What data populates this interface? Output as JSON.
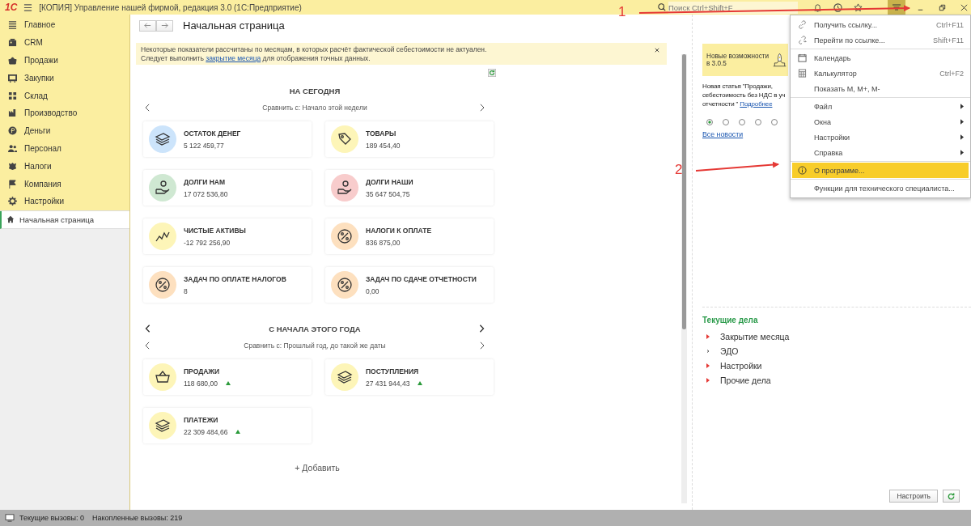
{
  "titlebar": {
    "logo": "1С",
    "title": "[КОПИЯ] Управление нашей фирмой, редакция 3.0  (1С:Предприятие)",
    "search": {
      "placeholder": "Поиск Ctrl+Shift+F"
    },
    "menu_open": true
  },
  "sidebar": {
    "items": [
      {
        "label": "Главное"
      },
      {
        "label": "CRM"
      },
      {
        "label": "Продажи"
      },
      {
        "label": "Закупки"
      },
      {
        "label": "Склад"
      },
      {
        "label": "Производство"
      },
      {
        "label": "Деньги"
      },
      {
        "label": "Персонал"
      },
      {
        "label": "Налоги"
      },
      {
        "label": "Компания"
      },
      {
        "label": "Настройки"
      }
    ],
    "open_windows": [
      {
        "label": "Начальная страница",
        "selected": true
      }
    ]
  },
  "page": {
    "title": "Начальная страница",
    "notice": {
      "line1": "Некоторые показатели рассчитаны по месяцам, в которых расчёт фактической себестоимости не актуален.",
      "line2_before": "Следует выполнить ",
      "link": "закрытие месяца",
      "line2_after": " для отображения точных данных."
    },
    "sections": [
      {
        "title": "НА СЕГОДНЯ",
        "outer_arrows": false,
        "compare": "Сравнить с: Начало этой недели",
        "cards": [
          {
            "title": "ОСТАТОК ДЕНЕГ",
            "value": "5 122 459,77",
            "kind": "money",
            "color": "#cce4fb",
            "up": false
          },
          {
            "title": "ТОВАРЫ",
            "value": "189 454,40",
            "kind": "tag",
            "color": "#fdf5b8",
            "up": false
          },
          {
            "title": "ДОЛГИ НАМ",
            "value": "17 072 536,80",
            "kind": "hand",
            "color": "#cfe8d2",
            "up": false
          },
          {
            "title": "ДОЛГИ НАШИ",
            "value": "35 647 504,75",
            "kind": "hand",
            "color": "#f8cccc",
            "up": false
          },
          {
            "title": "ЧИСТЫЕ АКТИВЫ",
            "value": "-12 792 256,90",
            "kind": "chart",
            "color": "#fdf5b8",
            "up": false
          },
          {
            "title": "НАЛОГИ К ОПЛАТЕ",
            "value": "836 875,00",
            "kind": "percent",
            "color": "#fde0bf",
            "up": false
          },
          {
            "title": "ЗАДАЧ ПО ОПЛАТЕ НАЛОГОВ",
            "value": "8",
            "kind": "percent",
            "color": "#fde0bf",
            "up": false
          },
          {
            "title": "ЗАДАЧ ПО СДАЧЕ ОТЧЕТНОСТИ",
            "value": "0,00",
            "kind": "percent",
            "color": "#fde0bf",
            "up": false
          }
        ]
      },
      {
        "title": "С НАЧАЛА ЭТОГО ГОДА",
        "outer_arrows": true,
        "compare": "Сравнить с: Прошлый год, до такой же даты",
        "cards": [
          {
            "title": "ПРОДАЖИ",
            "value": "118 680,00",
            "kind": "basket",
            "color": "#fdf5b8",
            "up": true
          },
          {
            "title": "ПОСТУПЛЕНИЯ",
            "value": "27 431 944,43",
            "kind": "money",
            "color": "#fdf5b8",
            "up": true
          },
          {
            "title": "ПЛАТЕЖИ",
            "value": "22 309 484,66",
            "kind": "money",
            "color": "#fdf5b8",
            "up": true
          }
        ]
      }
    ],
    "add": "+ Добавить"
  },
  "news": {
    "header": "Новые возможности в 3.0.5",
    "lines": [
      "Новая статья \"Продажи,",
      "себестоимость без НДС в уч",
      "отчетности \" "
    ],
    "link": "Подробнее",
    "pages": [
      {
        "selected": true
      },
      {
        "selected": false
      },
      {
        "selected": false
      },
      {
        "selected": false
      },
      {
        "selected": false
      }
    ],
    "all_link": "Все новости"
  },
  "tasks": {
    "title": "Текущие дела",
    "items": [
      {
        "label": "Закрытие месяца",
        "kind": "alert"
      },
      {
        "label": "ЭДО",
        "kind": "plain"
      },
      {
        "label": "Настройки",
        "kind": "alert"
      },
      {
        "label": "Прочие дела",
        "kind": "alert"
      }
    ],
    "buttons": [
      "Настроить"
    ]
  },
  "menu": {
    "items": [
      {
        "kind": "link",
        "label": "Получить ссылку...",
        "shortcut": "Ctrl+F11",
        "selected": false
      },
      {
        "kind": "go-link",
        "label": "Перейти по ссылке...",
        "shortcut": "Shift+F11",
        "selected": false
      },
      {
        "kind": "separator"
      },
      {
        "kind": "calendar",
        "label": "Календарь",
        "selected": false
      },
      {
        "kind": "calculator",
        "label": "Калькулятор",
        "shortcut": "Ctrl+F2",
        "selected": false
      },
      {
        "kind": "text",
        "label": "Показать M, M+, M-",
        "selected": false
      },
      {
        "kind": "separator"
      },
      {
        "kind": "submenu",
        "label": "Файл",
        "selected": false
      },
      {
        "kind": "submenu",
        "label": "Окна",
        "selected": false
      },
      {
        "kind": "submenu",
        "label": "Настройки",
        "selected": false
      },
      {
        "kind": "submenu",
        "label": "Справка",
        "selected": false
      },
      {
        "kind": "separator"
      },
      {
        "kind": "info",
        "label": "О программе...",
        "selected": true
      },
      {
        "kind": "separator"
      },
      {
        "kind": "text",
        "label": "Функции для технического специалиста...",
        "selected": false
      }
    ]
  },
  "annotations": [
    {
      "label": "1"
    },
    {
      "label": "2"
    }
  ],
  "status_bar": {
    "current_calls": "Текущие вызовы: 0",
    "total_calls": "Накопленные вызовы: 219"
  }
}
